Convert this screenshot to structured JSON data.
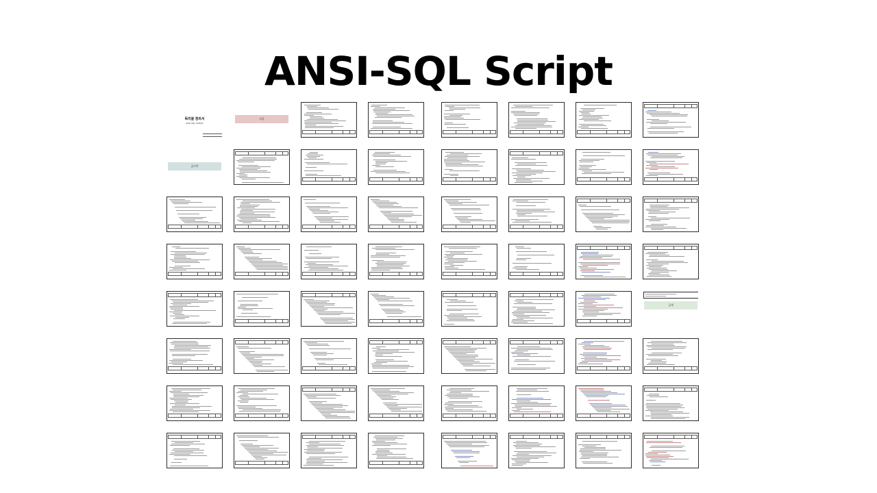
{
  "title": "ANSI-SQL Script",
  "special": {
    "cover_title": "독리율 정의서",
    "cover_subtitle": "ANSI SQL SCRIPT",
    "band_red": "오류",
    "band_teal": "공리적",
    "band_green": "공개"
  },
  "colors": {
    "band_red": "#e6c6c6",
    "band_teal": "#d3e0e0",
    "band_green": "#dceadb",
    "frame": "#2a2a2a"
  },
  "rows": 8,
  "columns": 8
}
